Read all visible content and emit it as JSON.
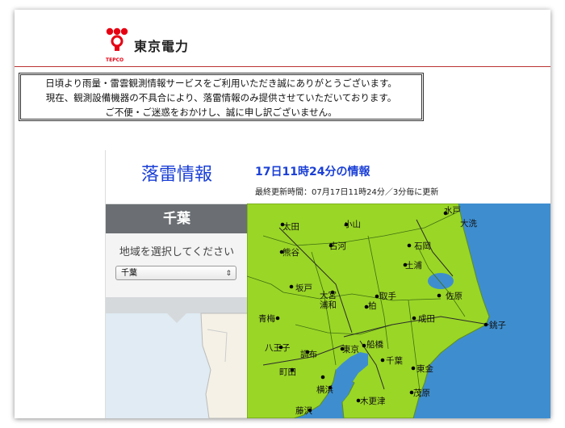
{
  "header": {
    "logo_text": "東京電力",
    "logo_sub": "TEPCO"
  },
  "notice": {
    "line1": "日頃より雨量・雷雲観測情報サービスをご利用いただき誠にありがとうございます。",
    "line2": "現在、観測設備機器の不具合により、落雷情報のみ提供させていただいております。",
    "line3": "ご不便・ご迷惑をおかけし、誠に申し訳ございません。"
  },
  "sidebar": {
    "title": "落雷情報",
    "region": "千葉",
    "select_label": "地域を選択してください",
    "select_value": "千葉"
  },
  "info": {
    "title": "17日11時24分の情報",
    "subtitle": "最終更新時間：07月17日11時24分／3分毎に更新"
  },
  "map": {
    "cities": [
      "水戸",
      "大洗",
      "太田",
      "小山",
      "古河",
      "石岡",
      "熊谷",
      "土浦",
      "坂戸",
      "大宮",
      "浦和",
      "取手",
      "佐原",
      "青梅",
      "柏",
      "成田",
      "銚子",
      "八王子",
      "東京",
      "船橋",
      "調布",
      "千葉",
      "町田",
      "東金",
      "横浜",
      "木更津",
      "茂原",
      "藤沢"
    ],
    "colors": {
      "land": "#9ad626",
      "sea": "#3e8ecf"
    }
  }
}
